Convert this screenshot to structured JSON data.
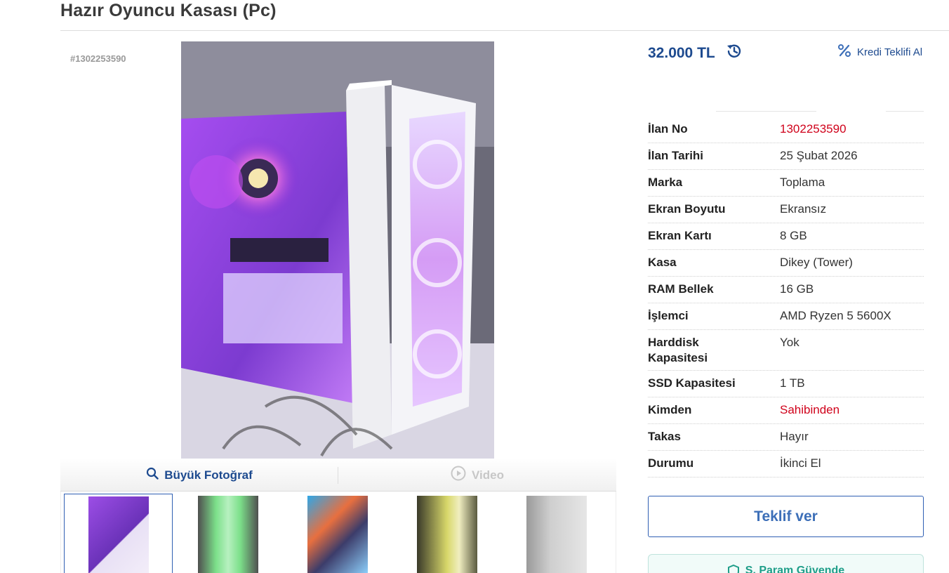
{
  "listing": {
    "title": "Hazır Oyuncu Kasası (Pc)",
    "image_overlay_id": "#1302253590"
  },
  "media": {
    "big_photo_label": "Büyük Fotoğraf",
    "video_label": "Video",
    "thumbnail_count": 5
  },
  "price": {
    "amount": "32.000 TL",
    "credit_label": "Kredi Teklifi Al"
  },
  "details": [
    {
      "key": "İlan No",
      "value": "1302253590"
    },
    {
      "key": "İlan Tarihi",
      "value": "25 Şubat 2026"
    },
    {
      "key": "Marka",
      "value": "Toplama"
    },
    {
      "key": "Ekran Boyutu",
      "value": "Ekransız"
    },
    {
      "key": "Ekran Kartı",
      "value": "8 GB"
    },
    {
      "key": "Kasa",
      "value": "Dikey (Tower)"
    },
    {
      "key": "RAM Bellek",
      "value": "16 GB"
    },
    {
      "key": "İşlemci",
      "value": "AMD Ryzen 5 5600X"
    },
    {
      "key": "Harddisk Kapasitesi",
      "value": "Yok"
    },
    {
      "key": "SSD Kapasitesi",
      "value": "1 TB"
    },
    {
      "key": "Kimden",
      "value": "Sahibinden"
    },
    {
      "key": "Takas",
      "value": "Hayır"
    },
    {
      "key": "Durumu",
      "value": "İkinci El"
    }
  ],
  "actions": {
    "offer_label": "Teklif ver",
    "safe_label": "S. Param Güvende"
  },
  "colors": {
    "brand_blue": "#1d4a8f",
    "accent_red": "#d0021b",
    "safe_green": "#1f9e89"
  },
  "icons": {
    "search": "search-icon",
    "play": "play-icon",
    "history": "price-history-icon",
    "percent": "percent-icon",
    "shield": "shield-icon"
  }
}
